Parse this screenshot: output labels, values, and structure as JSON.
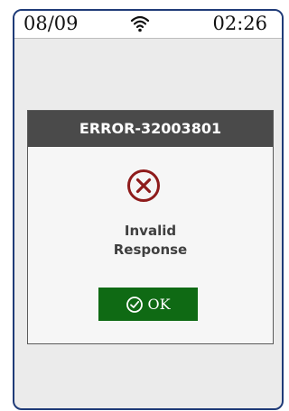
{
  "status_bar": {
    "date": "08/09",
    "time": "02:26",
    "wifi_icon": "wifi-icon"
  },
  "dialog": {
    "title": "ERROR-32003801",
    "icon": "error-circle-x-icon",
    "message_line1": "Invalid",
    "message_line2": "Response",
    "ok_button": {
      "label": "OK",
      "icon": "check-circle-icon"
    }
  },
  "colors": {
    "frame_border": "#1f3b78",
    "screen_background": "#ebebeb",
    "dialog_header": "#4a4a4a",
    "error_icon": "#8e1b1b",
    "ok_button": "#0f6a14"
  }
}
